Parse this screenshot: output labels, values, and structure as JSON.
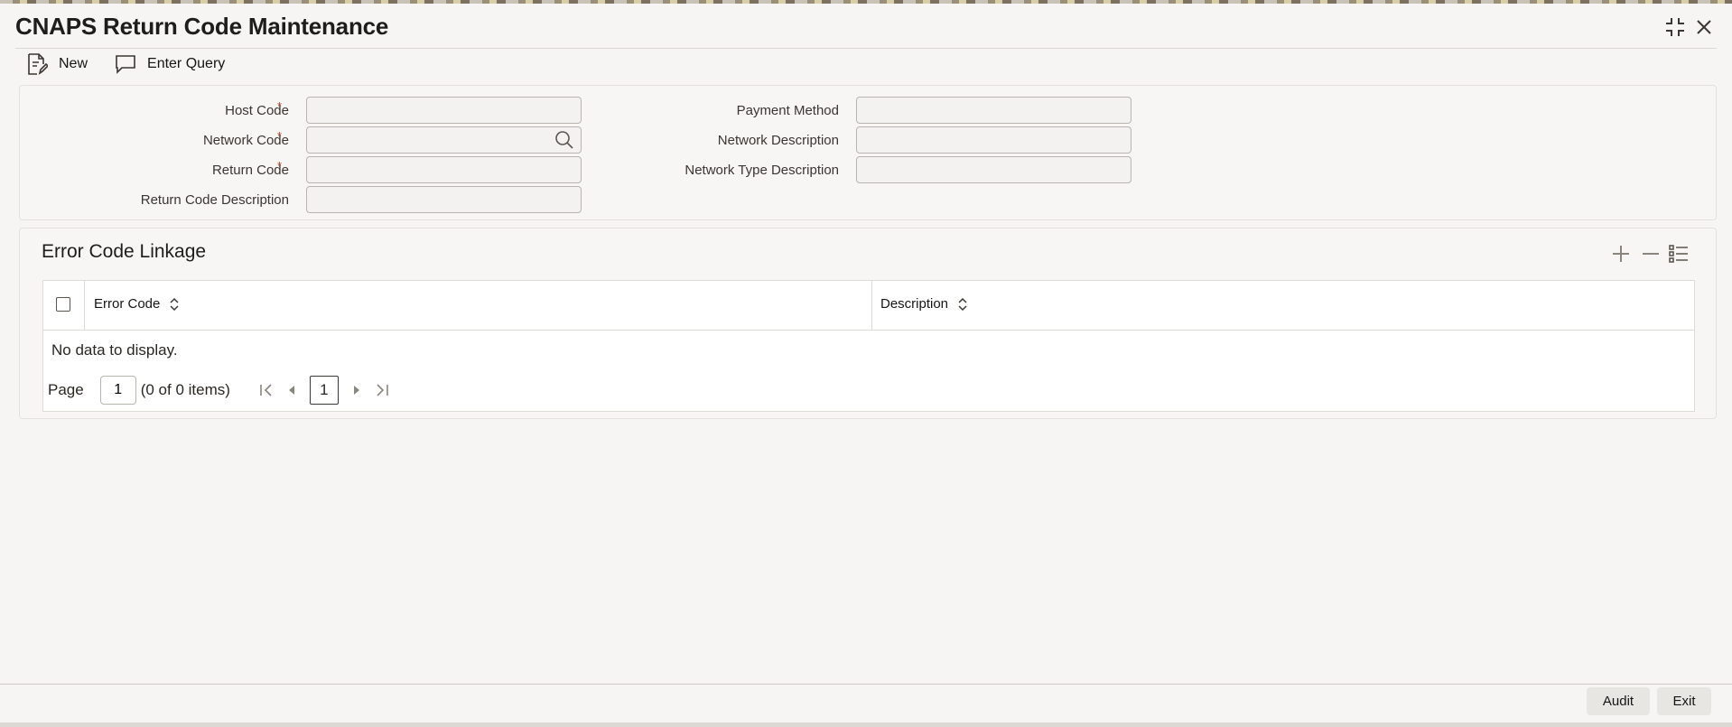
{
  "window": {
    "title": "CNAPS Return Code Maintenance"
  },
  "toolbar": {
    "new_label": "New",
    "enter_query_label": "Enter Query"
  },
  "form": {
    "host_code": {
      "label": "Host Code",
      "value": ""
    },
    "network_code": {
      "label": "Network Code",
      "value": ""
    },
    "return_code": {
      "label": "Return Code",
      "value": ""
    },
    "return_code_description": {
      "label": "Return Code Description",
      "value": ""
    },
    "payment_method": {
      "label": "Payment Method",
      "value": ""
    },
    "network_description": {
      "label": "Network Description",
      "value": ""
    },
    "network_type_description": {
      "label": "Network Type Description",
      "value": ""
    },
    "required_marker": "*"
  },
  "error_code_linkage": {
    "title": "Error Code Linkage",
    "columns": [
      "Error Code",
      "Description"
    ],
    "rows": [],
    "empty_message": "No data to display.",
    "pagination": {
      "page_label": "Page",
      "page_value": "1",
      "items_summary": "(0 of 0 items)",
      "current_page": "1"
    }
  },
  "footer": {
    "audit_label": "Audit",
    "exit_label": "Exit"
  }
}
